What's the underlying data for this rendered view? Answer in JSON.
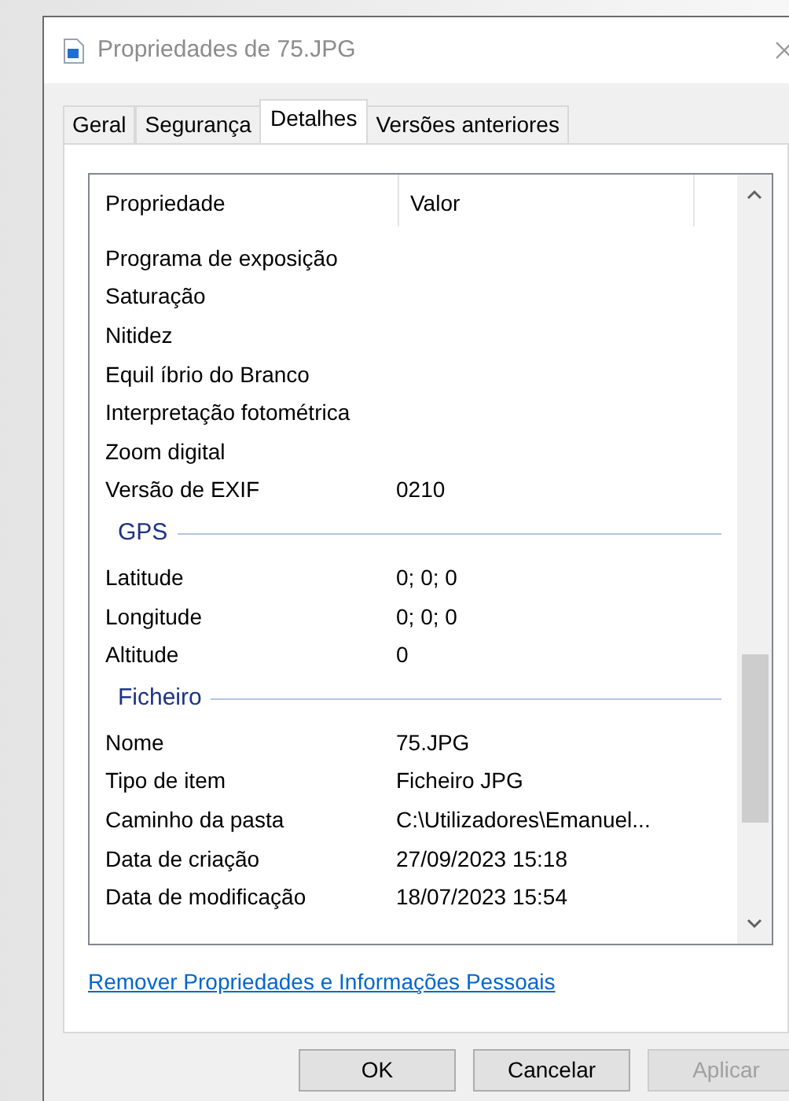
{
  "window": {
    "title": "Propriedades de 75.JPG"
  },
  "tabs": [
    {
      "label": "Geral",
      "selected": false
    },
    {
      "label": "Segurança",
      "selected": false
    },
    {
      "label": "Detalhes",
      "selected": true
    },
    {
      "label": "Versões anteriores",
      "selected": false
    }
  ],
  "list": {
    "columns": [
      "Propriedade",
      "Valor"
    ],
    "rows": [
      {
        "kind": "property",
        "name": "Programa de exposição"
      },
      {
        "kind": "property",
        "name": "Saturação"
      },
      {
        "kind": "property",
        "name": "Nitidez"
      },
      {
        "kind": "property",
        "name": "Equil íbrio do Branco"
      },
      {
        "kind": "property",
        "name": "Interpretação fotométrica"
      },
      {
        "kind": "property",
        "name": "Zoom digital"
      },
      {
        "kind": "property",
        "name": "Versão de EXIF",
        "value": "0210"
      },
      {
        "kind": "group",
        "name": "GPS"
      },
      {
        "kind": "property",
        "name": "Latitude",
        "value": "0; 0; 0"
      },
      {
        "kind": "property",
        "name": "Longitude",
        "value": "0; 0; 0"
      },
      {
        "kind": "property",
        "name": "Altitude",
        "value": "0"
      },
      {
        "kind": "group",
        "name": "Ficheiro"
      },
      {
        "kind": "property",
        "name": "Nome",
        "value": "75.JPG"
      },
      {
        "kind": "property",
        "name": "Tipo de item",
        "value": "Ficheiro JPG"
      },
      {
        "kind": "property",
        "name": "Caminho da pasta",
        "value": "C:\\Utilizadores\\Emanuel..."
      },
      {
        "kind": "property",
        "name": "Data de criação",
        "value": "27/09/2023 15:18"
      },
      {
        "kind": "property",
        "name": "Data de modificação",
        "value": "18/07/2023 15:54"
      }
    ]
  },
  "link": "Remover Propriedades e Informações Pessoais",
  "buttons": [
    {
      "label": "OK",
      "disabled": false
    },
    {
      "label": "Cancelar",
      "disabled": false
    },
    {
      "label": "Aplicar",
      "disabled": true
    }
  ]
}
